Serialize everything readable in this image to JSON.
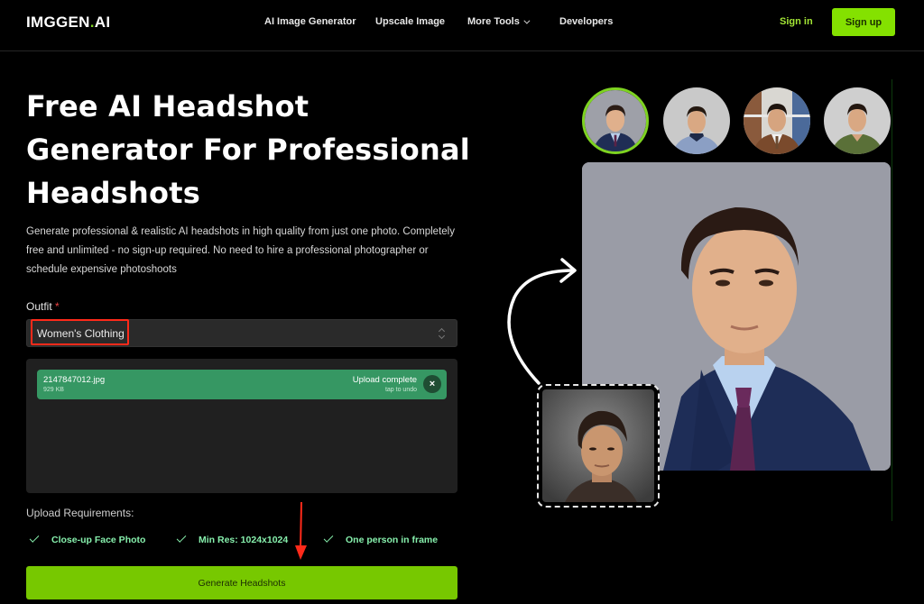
{
  "header": {
    "logo_main": "IMGGEN",
    "logo_dot": ".",
    "logo_suffix": "AI",
    "nav": [
      {
        "label": "AI Image Generator"
      },
      {
        "label": "Upscale Image"
      },
      {
        "label": "More Tools",
        "icon": "chevron-down-icon"
      },
      {
        "label": "Developers"
      }
    ],
    "signin_label": "Sign in",
    "signup_label": "Sign up"
  },
  "hero": {
    "title_lines": [
      "Free AI Headshot",
      "Generator For Professional",
      "Headshots"
    ],
    "description": "Generate professional & realistic AI headshots in high quality from just one photo. Completely free and unlimited - no sign-up required. No need to hire a professional photographer or schedule expensive photoshoots"
  },
  "form": {
    "outfit_label": "Outfit",
    "required_marker": "*",
    "outfit_value": "Women's Clothing",
    "upload": {
      "file_name": "2147847012.jpg",
      "file_size": "929 KB",
      "status": "Upload complete",
      "hint": "tap to undo",
      "remove_icon": "×"
    },
    "requirements_title": "Upload Requirements:",
    "requirements": [
      {
        "label": "Close-up Face Photo"
      },
      {
        "label": "Min Res: 1024x1024"
      },
      {
        "label": "One person in frame"
      }
    ],
    "generate_label": "Generate Headshots"
  },
  "showcase": {
    "styles": [
      {
        "name": "navy-suit",
        "selected": true
      },
      {
        "name": "polo-shirt",
        "selected": false
      },
      {
        "name": "brown-suit-library",
        "selected": false
      },
      {
        "name": "green-shirt",
        "selected": false
      }
    ]
  },
  "colors": {
    "accent": "#84e100",
    "upload_success": "#369763",
    "annotation": "#ff2a1a"
  }
}
